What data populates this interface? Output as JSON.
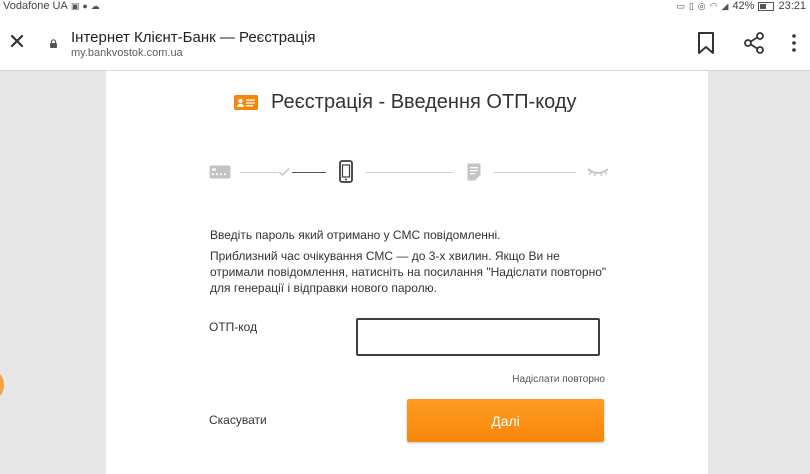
{
  "status_bar": {
    "carrier": "Vodafone UA",
    "battery": "42%",
    "time": "23:21"
  },
  "browser": {
    "page_title": "Інтернет Клієнт-Банк — Реєстрація",
    "url": "my.bankvostok.com.ua"
  },
  "page": {
    "heading": "Реєстрація - Введення ОТП-коду",
    "steps": [
      {
        "icon": "card-icon",
        "state": "done"
      },
      {
        "icon": "phone-icon",
        "state": "active"
      },
      {
        "icon": "document-icon",
        "state": "pending"
      },
      {
        "icon": "eye-closed-icon",
        "state": "pending"
      }
    ],
    "instruction": "Введіть пароль який отримано у СМС повідомленні.",
    "note": "Приблизний час очікування СМС — до 3-х хвилин. Якщо Ви не отримали повідомлення, натисніть на посилання \"Надіслати повторно\" для генерації і відправки нового паролю.",
    "otp_label": "ОТП-код",
    "otp_value": "",
    "resend_link": "Надіслати повторно",
    "cancel_link": "Скасувати",
    "next_button": "Далі"
  },
  "colors": {
    "accent": "#f7860a",
    "card_background": "#ffffff",
    "page_background": "#e7e7e7"
  }
}
